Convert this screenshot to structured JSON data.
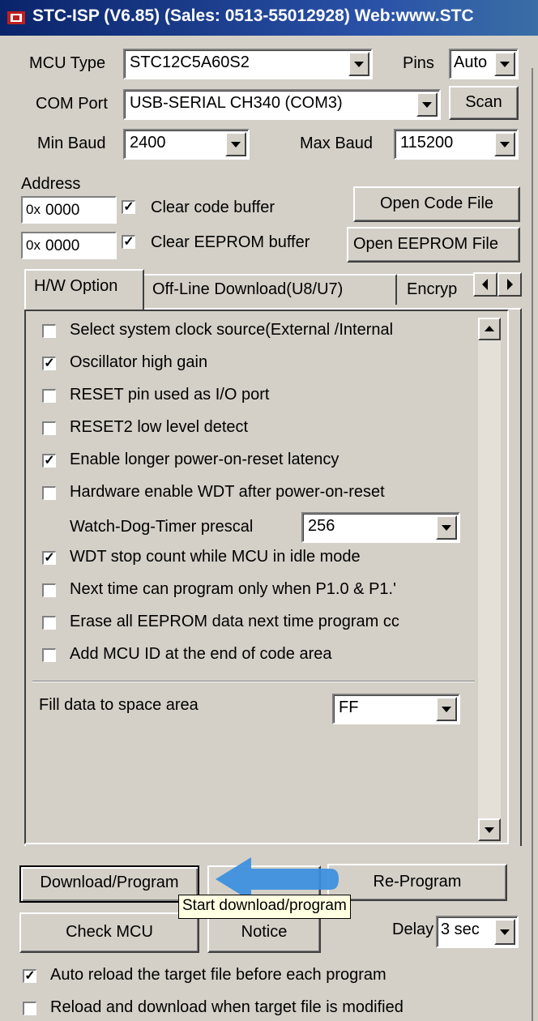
{
  "window": {
    "title": "STC-ISP (V6.85) (Sales: 0513-55012928) Web:www.STC"
  },
  "mcu": {
    "label": "MCU Type",
    "value": "STC12C5A60S2",
    "pins_label": "Pins",
    "pins_value": "Auto"
  },
  "com": {
    "label": "COM Port",
    "value": "USB-SERIAL CH340 (COM3)",
    "scan_label": "Scan"
  },
  "baud": {
    "min_label": "Min Baud",
    "min_value": "2400",
    "max_label": "Max Baud",
    "max_value": "115200"
  },
  "address": {
    "label": "Address",
    "code": {
      "prefix": "0x",
      "value": "0000",
      "clear_label": "Clear code buffer",
      "clear_checked": "☑",
      "open_label": "Open Code File"
    },
    "eeprom": {
      "prefix": "0x",
      "value": "0000",
      "clear_label": "Clear EEPROM buffer",
      "clear_checked": "☑",
      "open_label": "Open EEPROM File"
    }
  },
  "tabs": [
    "H/W Option",
    "Off-Line Download(U8/U7)",
    "Encryp"
  ],
  "options": [
    {
      "label": "Select system clock source(External /Internal",
      "checked": ""
    },
    {
      "label": "Oscillator high gain",
      "checked": "✓"
    },
    {
      "label": "RESET pin used as I/O port",
      "checked": ""
    },
    {
      "label": "RESET2 low level detect",
      "checked": ""
    },
    {
      "label": "Enable longer power-on-reset latency",
      "checked": "✓"
    },
    {
      "label": "Hardware enable WDT after power-on-reset",
      "checked": ""
    },
    {
      "label": "WDT stop count while MCU in idle mode",
      "checked": "✓"
    },
    {
      "label": "Next time can program only when P1.0 & P1.'",
      "checked": ""
    },
    {
      "label": "Erase all EEPROM data next time program cc",
      "checked": ""
    },
    {
      "label": "Add MCU ID at the end of code area",
      "checked": ""
    }
  ],
  "wdt": {
    "label": "Watch-Dog-Timer prescal",
    "value": "256"
  },
  "fill": {
    "label": "Fill data to space area",
    "value": "FF"
  },
  "actions": {
    "download": "Download/Program",
    "reprogram": "Re-Program",
    "tooltip": "Start download/program",
    "check": "Check MCU",
    "notice": "Notice",
    "delay_label": "Delay",
    "delay_value": "3 sec"
  },
  "bottom": {
    "auto_reload": {
      "label": "Auto reload the target file before each program",
      "checked": "✓"
    },
    "reload_modified": {
      "label": "Reload and download when target file is modified",
      "checked": ""
    }
  },
  "colors": {
    "title_bg": "#0a246a",
    "annotation_arrow": "#3a8ee0",
    "tooltip_bg": "#ffffe1"
  }
}
